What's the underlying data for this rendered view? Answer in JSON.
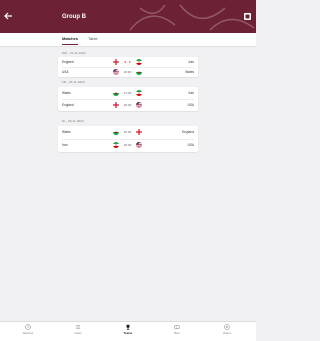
{
  "header": {
    "title": "Group B"
  },
  "tabs": [
    {
      "label": "Matches",
      "active": true
    },
    {
      "label": "Table",
      "active": false
    }
  ],
  "days": [
    {
      "date": "MO., 21.11.2022",
      "matches": [
        {
          "home": "England",
          "away": "Iran",
          "score": "6 - 2",
          "live": true
        },
        {
          "home": "USA",
          "away": "Wales",
          "score": "20:00",
          "live": false
        }
      ]
    },
    {
      "date": "FR., 25.11.2022",
      "matches": [
        {
          "home": "Wales",
          "away": "Iran",
          "score": "11:00",
          "live": false
        },
        {
          "home": "England",
          "away": "USA",
          "score": "20:00",
          "live": false
        }
      ]
    },
    {
      "date": "DI., 29.11.2022",
      "matches": [
        {
          "home": "Wales",
          "away": "England",
          "score": "20:00",
          "live": false
        },
        {
          "home": "Iran",
          "away": "USA",
          "score": "20:00",
          "live": false
        }
      ]
    }
  ],
  "nav": [
    {
      "label": "Matches",
      "icon": "calendar-icon"
    },
    {
      "label": "News",
      "icon": "news-icon"
    },
    {
      "label": "Teams",
      "icon": "trophy-icon",
      "active": true
    },
    {
      "label": "Bets",
      "icon": "ticket-icon"
    },
    {
      "label": "Videos",
      "icon": "play-icon"
    }
  ],
  "colors": {
    "brand": "#6d2135",
    "live": "#c0392b"
  }
}
